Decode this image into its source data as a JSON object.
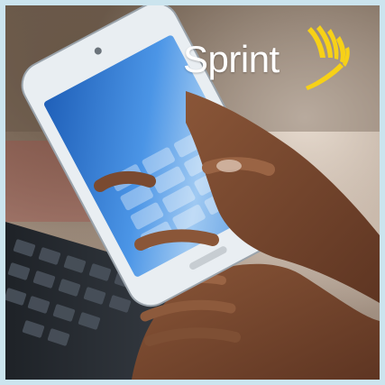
{
  "brand": {
    "name": "Sprint",
    "logo_color": "#ffffff",
    "wing_color": "#f7d117"
  },
  "scene": {
    "frame_color": "#cbe4ee",
    "phone_screen_color": "#2f7fd6",
    "skin_color": "#7a4a30",
    "keyboard_color": "#2a2f36"
  }
}
